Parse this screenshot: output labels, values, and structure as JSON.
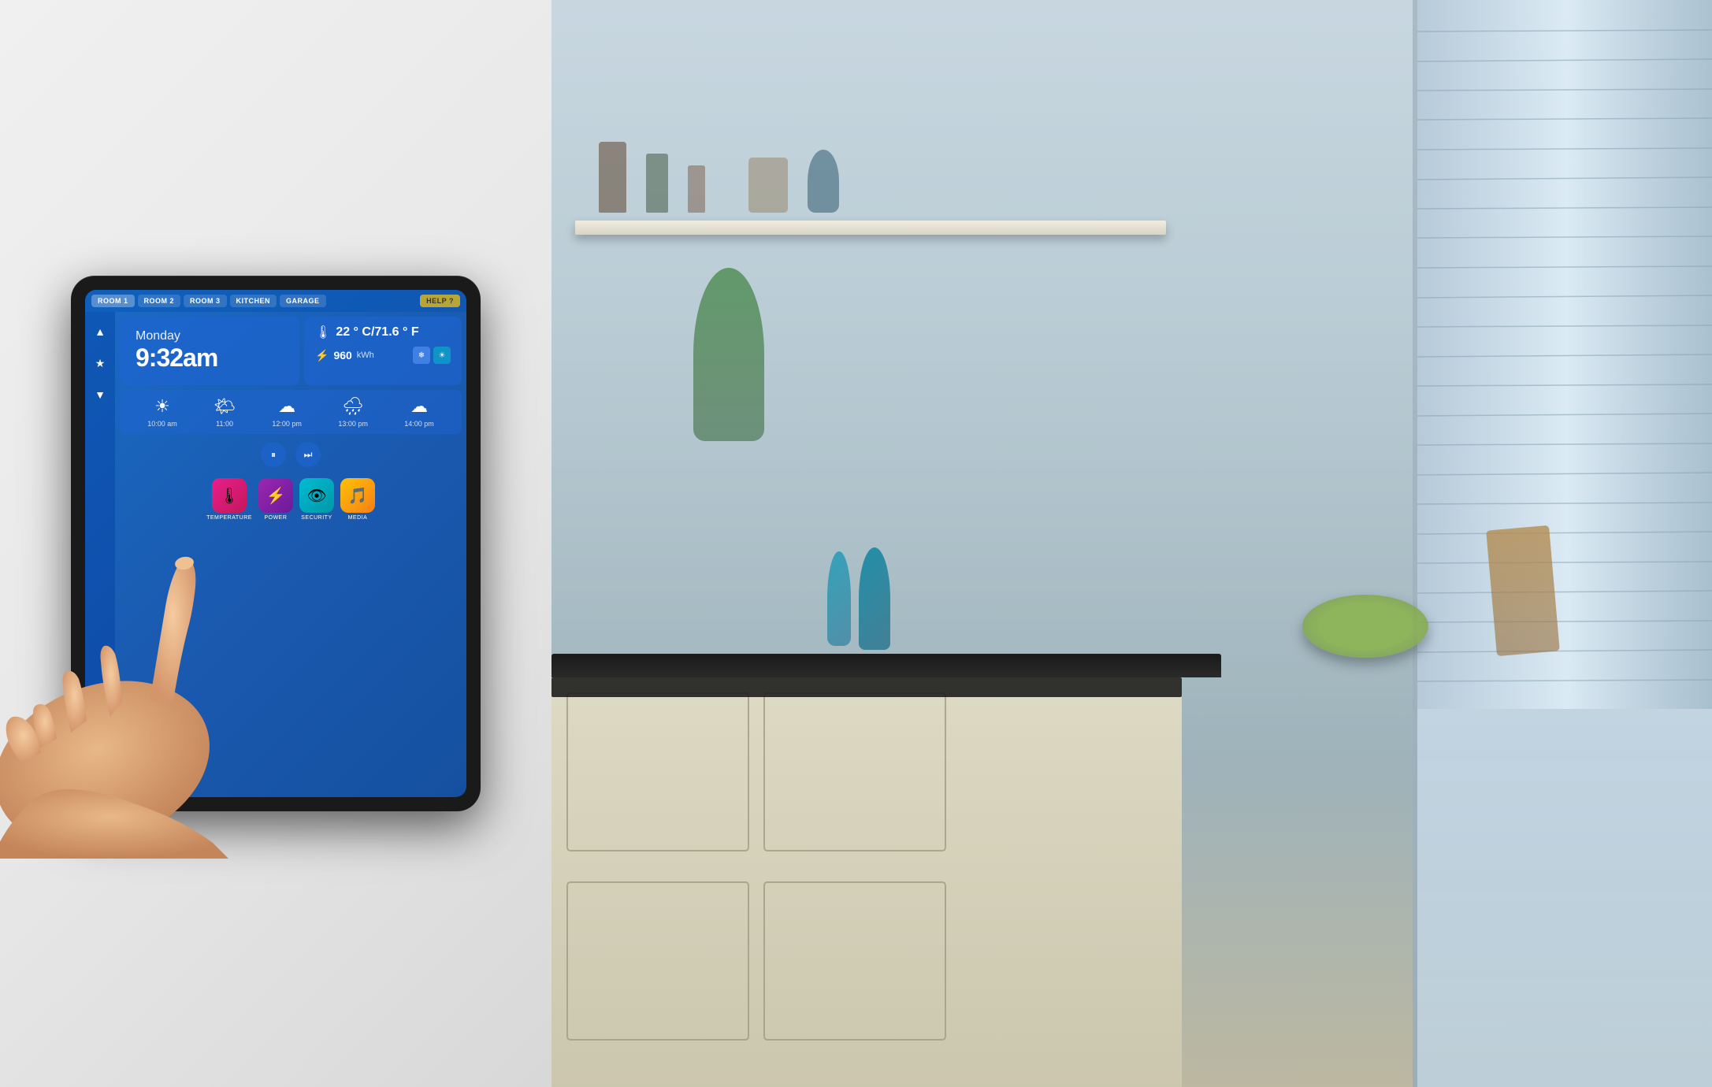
{
  "tabs": [
    {
      "label": "ROOM 1",
      "state": "active"
    },
    {
      "label": "ROOM 2",
      "state": "inactive"
    },
    {
      "label": "ROOM 3",
      "state": "inactive"
    },
    {
      "label": "KITCHEN",
      "state": "inactive"
    },
    {
      "label": "GARAGE",
      "state": "inactive"
    },
    {
      "label": "HELP ?",
      "state": "help"
    }
  ],
  "sidebar": {
    "icons": [
      "▲",
      "★",
      "▼"
    ]
  },
  "time_widget": {
    "day": "Monday",
    "time": "9:32am"
  },
  "info_widget": {
    "temp": "22 ° C/71.6 ° F",
    "energy_value": "960",
    "energy_unit": "kWh",
    "btn1": "❄",
    "btn2": "☀"
  },
  "weather": [
    {
      "icon": "☀",
      "time": "10:00 am"
    },
    {
      "icon": "🌤",
      "time": "11:00"
    },
    {
      "icon": "☁",
      "time": "12:00 pm"
    },
    {
      "icon": "🌧",
      "time": "13:00 pm"
    },
    {
      "icon": "☁",
      "time": "14:00 pm"
    }
  ],
  "media_controls": {
    "pause": "⏸",
    "forward": "⏭"
  },
  "app_icons": [
    {
      "label": "TEMPERATURE",
      "icon": "🌡",
      "class": "icon-temp"
    },
    {
      "label": "POWER",
      "icon": "⚡",
      "class": "icon-power"
    },
    {
      "label": "SECURITY",
      "icon": "👁",
      "class": "icon-security"
    },
    {
      "label": "MEDIA",
      "icon": "🎵",
      "class": "icon-media"
    }
  ]
}
